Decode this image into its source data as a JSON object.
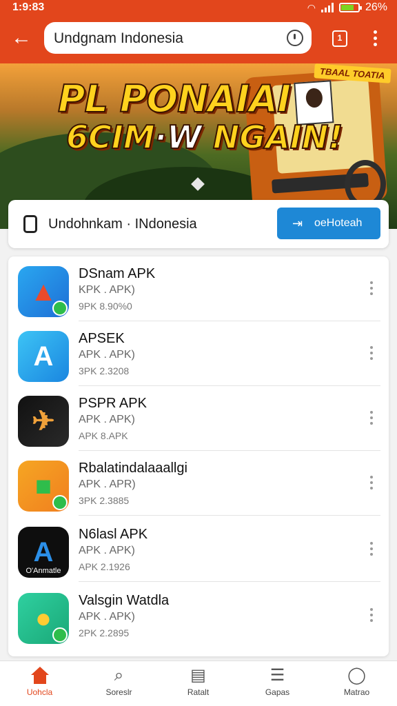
{
  "status_bar": {
    "time": "1:9:83",
    "battery": "26%"
  },
  "browser": {
    "url": "Undgnam Indonesia",
    "tabs_count": "1"
  },
  "banner": {
    "badge": "TBAAL TOATIA",
    "line1": "PL PONAIAI",
    "line2_a": "6CIM",
    "line2_w": "·W",
    "line2_b": " NGAIN!"
  },
  "site_card": {
    "title": "Undohnkam · INdonesia",
    "button_label": "oeHoteah"
  },
  "apps": [
    {
      "name": "DSnam APK",
      "type": "KPK . APK)",
      "size": "9PK 8.90%0",
      "icon": "play-arrow-icon",
      "color": "#e94a2b",
      "bg": "linear-gradient(135deg,#2aa7f0,#1e6fd6)",
      "glyph": "▲"
    },
    {
      "name": "APSEK",
      "type": "APK . APK)",
      "size": "3PK 2.3208",
      "icon": "store-a-icon",
      "color": "#ffffff",
      "bg": "linear-gradient(135deg,#3dc4f5,#1a86e0)",
      "glyph": "A"
    },
    {
      "name": "PSPR APK",
      "type": "APK . APK)",
      "size": "APK 8.APK",
      "icon": "rocket-icon",
      "color": "#f0a13a",
      "bg": "linear-gradient(135deg,#111,#2a2a2a)",
      "glyph": "✈"
    },
    {
      "name": "Rbalatindalaaallgi",
      "type": "APK . APR)",
      "size": "3PK 2.3885",
      "icon": "leaf-icon",
      "color": "#2fbd4b",
      "bg": "linear-gradient(135deg,#f6a623,#f07f1f)",
      "glyph": "■"
    },
    {
      "name": "N6lasl APK",
      "type": "APK . APK)",
      "size": "APK 2.1926",
      "icon": "triangle-a-icon",
      "color": "#2b8fe8",
      "bg": "#0e0e0e",
      "glyph": "A",
      "caption": "O'Anmatle"
    },
    {
      "name": "Valsgin Watdla",
      "type": "APK . APK)",
      "size": "2PK 2.2895",
      "icon": "turtle-icon",
      "color": "#ffcc33",
      "bg": "linear-gradient(135deg,#2fd0a0,#1aa877)",
      "glyph": "●"
    }
  ],
  "bottom_nav": [
    {
      "label": "Uohcla",
      "icon": "home-icon",
      "active": true
    },
    {
      "label": "Soreslr",
      "icon": "search-icon",
      "active": false
    },
    {
      "label": "Ratalt",
      "icon": "document-icon",
      "active": false
    },
    {
      "label": "Gapas",
      "icon": "list-icon",
      "active": false
    },
    {
      "label": "Matrao",
      "icon": "profile-icon",
      "active": false
    }
  ],
  "colors": {
    "primary": "#e2461c",
    "button_blue": "#1e88d6",
    "active_nav": "#e2461c"
  }
}
